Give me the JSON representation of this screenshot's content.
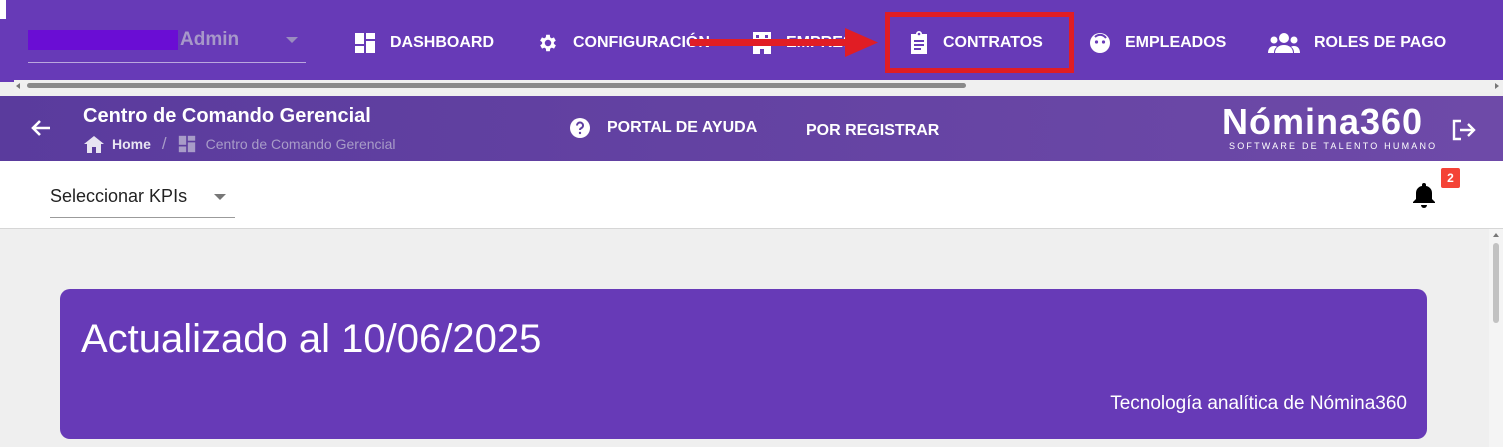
{
  "user": {
    "name": "Admin"
  },
  "nav": {
    "dashboard": "DASHBOARD",
    "configuracion": "CONFIGURACIÓN",
    "empresa": "EMPRESA",
    "contratos": "CONTRATOS",
    "empleados": "EMPLEADOS",
    "roles": "ROLES DE PAGO"
  },
  "header": {
    "title": "Centro de Comando Gerencial",
    "breadcrumb_home": "Home",
    "breadcrumb_sep": "/",
    "breadcrumb_current": "Centro de Comando Gerencial",
    "help": "PORTAL DE AYUDA",
    "register": "POR REGISTRAR",
    "brand_name": "Nómina360",
    "brand_tagline": "SOFTWARE DE TALENTO HUMANO"
  },
  "kpi": {
    "select_label": "Seleccionar KPIs"
  },
  "notifications": {
    "count": "2"
  },
  "card": {
    "title": "Actualizado al 10/06/2025",
    "subtitle": "Tecnología analítica de Nómina360"
  },
  "colors": {
    "primary": "#673ab7",
    "highlight": "#e11d24",
    "badge": "#f44336"
  }
}
